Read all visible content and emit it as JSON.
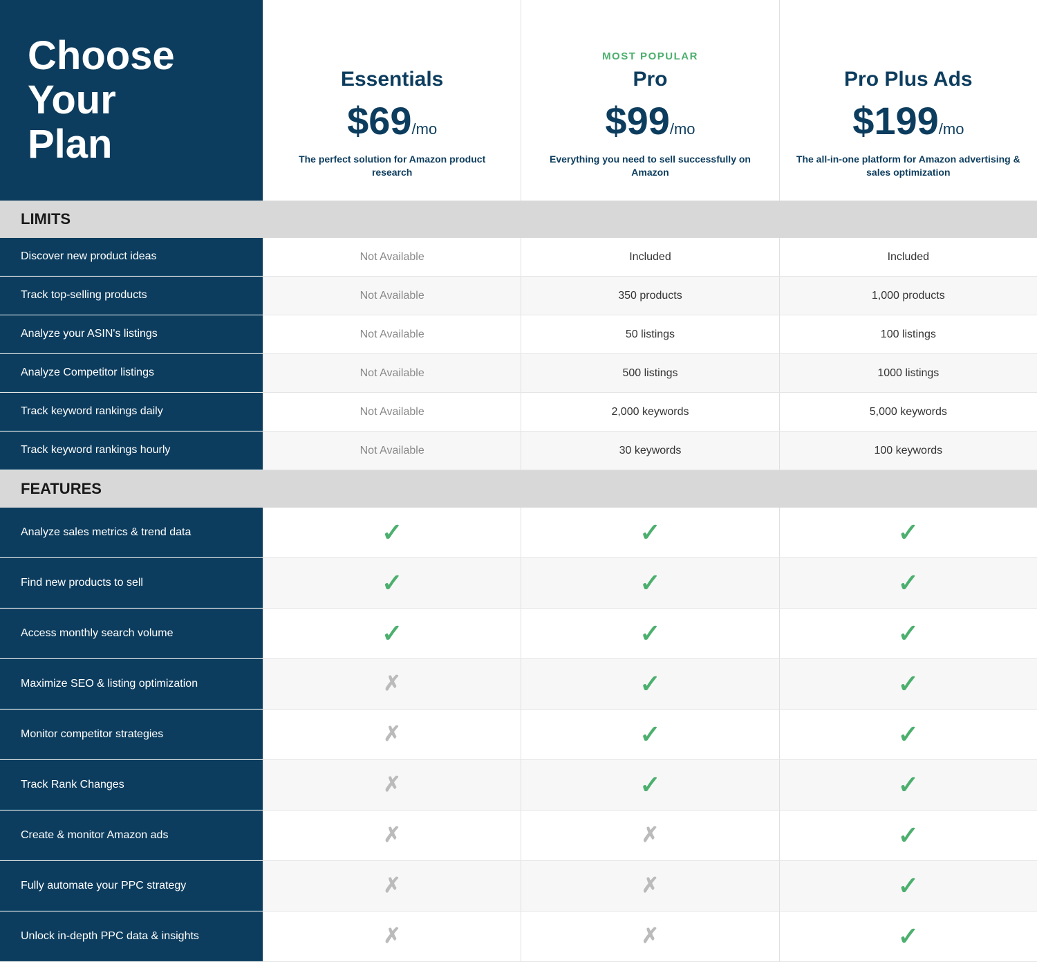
{
  "header": {
    "title_line1": "Choose",
    "title_line2": "Your",
    "title_line3": "Plan"
  },
  "plans": [
    {
      "id": "essentials",
      "most_popular": false,
      "badge": "",
      "name": "Essentials",
      "price": "$69",
      "per": "/mo",
      "description": "The perfect solution for Amazon product research"
    },
    {
      "id": "pro",
      "most_popular": true,
      "badge": "MOST POPULAR",
      "name": "Pro",
      "price": "$99",
      "per": "/mo",
      "description": "Everything you need to sell successfully on Amazon"
    },
    {
      "id": "pro-plus-ads",
      "most_popular": false,
      "badge": "",
      "name": "Pro Plus Ads",
      "price": "$199",
      "per": "/mo",
      "description": "The all-in-one platform for Amazon advertising & sales optimization"
    }
  ],
  "sections": {
    "limits_label": "LIMITS",
    "features_label": "FEATURES"
  },
  "limits_rows": [
    {
      "label": "Discover new product ideas",
      "essentials": "Not Available",
      "pro": "Included",
      "pro_plus_ads": "Included"
    },
    {
      "label": "Track top-selling products",
      "essentials": "Not Available",
      "pro": "350 products",
      "pro_plus_ads": "1,000 products"
    },
    {
      "label": "Analyze your ASIN's listings",
      "essentials": "Not Available",
      "pro": "50 listings",
      "pro_plus_ads": "100 listings"
    },
    {
      "label": "Analyze Competitor listings",
      "essentials": "Not Available",
      "pro": "500 listings",
      "pro_plus_ads": "1000 listings"
    },
    {
      "label": "Track keyword rankings daily",
      "essentials": "Not Available",
      "pro": "2,000 keywords",
      "pro_plus_ads": "5,000 keywords"
    },
    {
      "label": "Track keyword rankings hourly",
      "essentials": "Not Available",
      "pro": "30 keywords",
      "pro_plus_ads": "100 keywords"
    }
  ],
  "features_rows": [
    {
      "label": "Analyze sales metrics & trend data",
      "essentials": "check",
      "pro": "check",
      "pro_plus_ads": "check"
    },
    {
      "label": "Find new products to sell",
      "essentials": "check",
      "pro": "check",
      "pro_plus_ads": "check"
    },
    {
      "label": "Access monthly search volume",
      "essentials": "check",
      "pro": "check",
      "pro_plus_ads": "check"
    },
    {
      "label": "Maximize SEO & listing optimization",
      "essentials": "x",
      "pro": "check",
      "pro_plus_ads": "check"
    },
    {
      "label": "Monitor competitor strategies",
      "essentials": "x",
      "pro": "check",
      "pro_plus_ads": "check"
    },
    {
      "label": "Track Rank Changes",
      "essentials": "x",
      "pro": "check",
      "pro_plus_ads": "check"
    },
    {
      "label": "Create & monitor Amazon ads",
      "essentials": "x",
      "pro": "x",
      "pro_plus_ads": "check"
    },
    {
      "label": "Fully automate your PPC strategy",
      "essentials": "x",
      "pro": "x",
      "pro_plus_ads": "check"
    },
    {
      "label": "Unlock in-depth PPC data & insights",
      "essentials": "x",
      "pro": "x",
      "pro_plus_ads": "check"
    }
  ],
  "not_available_text": "Not Available"
}
